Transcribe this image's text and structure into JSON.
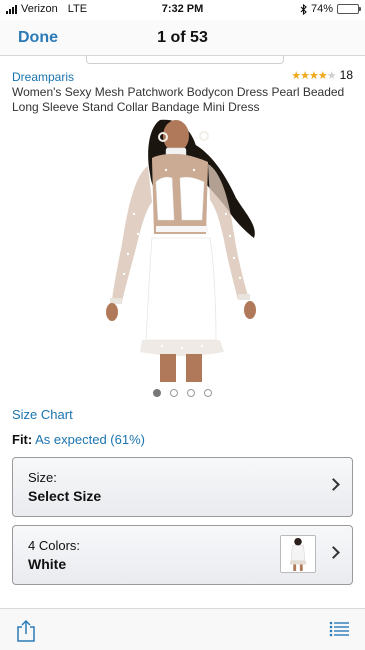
{
  "status_bar": {
    "carrier": "Verizon",
    "network": "LTE",
    "time": "7:32 PM",
    "battery": "74%",
    "battery_level": 0.74
  },
  "nav": {
    "done_label": "Done",
    "title": "1 of 53"
  },
  "product": {
    "brand": "Dreamparis",
    "rating_count": "18",
    "stars_filled": 4,
    "stars_total": 5,
    "title": "Women's Sexy Mesh Patchwork Bodycon Dress Pearl Beaded Long Sleeve Stand Collar Bandage Mini Dress",
    "image_count": 4,
    "active_image_index": 0
  },
  "size_chart_label": "Size Chart",
  "fit": {
    "label": "Fit:",
    "value": "As expected (61%)"
  },
  "size_option": {
    "label": "Size:",
    "value": "Select Size"
  },
  "color_option": {
    "label": "4 Colors:",
    "value": "White"
  },
  "colors": {
    "accent": "#1a74b0",
    "star": "#f0a81c",
    "battery": "#f5c518"
  },
  "icons": {
    "share": "share-icon",
    "list": "list-icon",
    "chevron": "chevron-right-icon"
  }
}
